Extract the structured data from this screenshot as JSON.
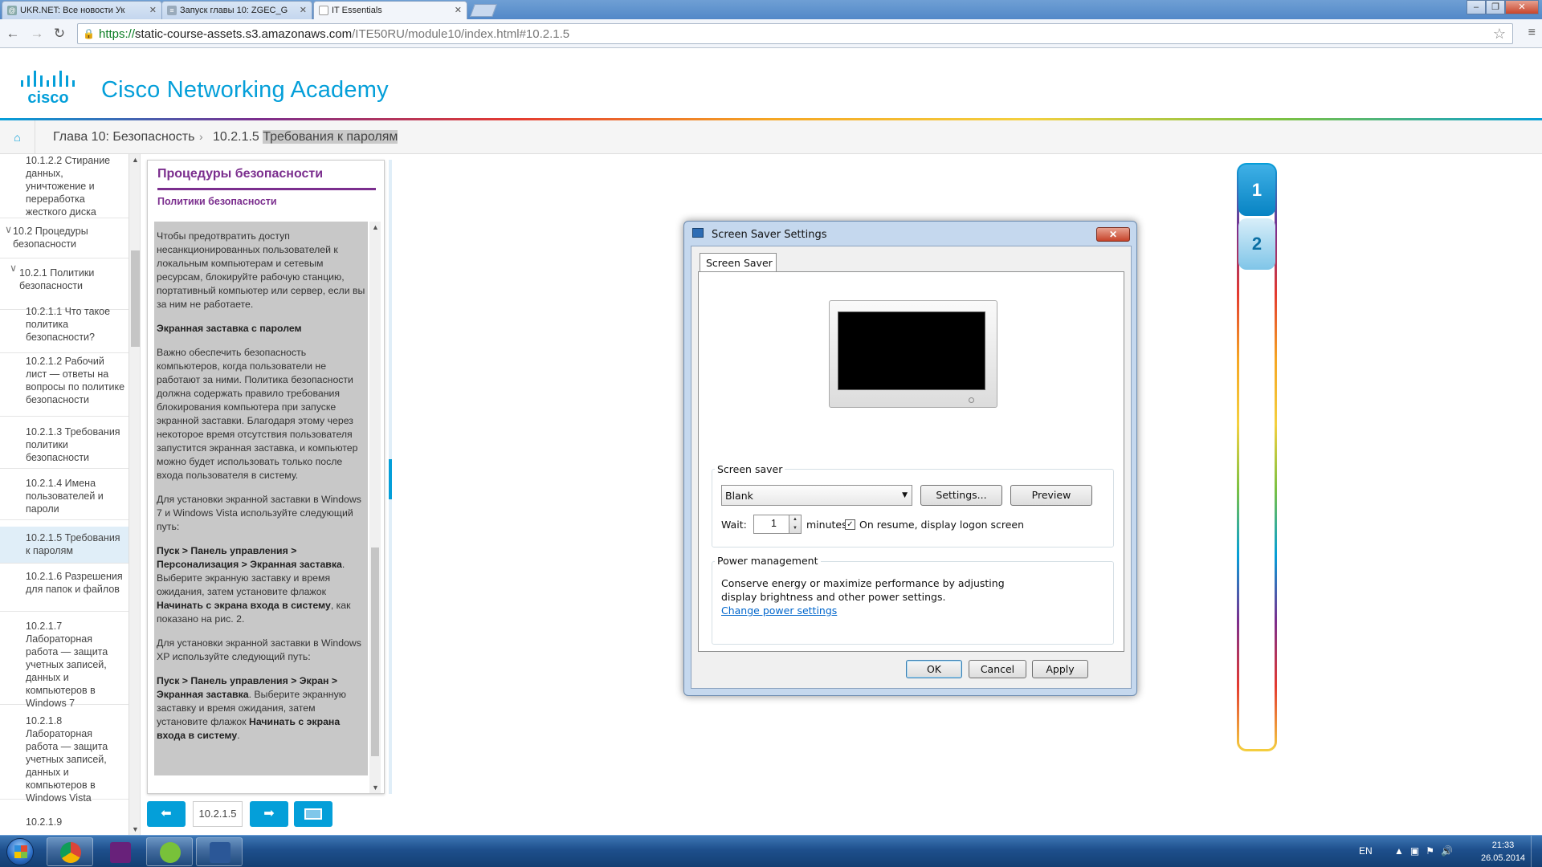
{
  "browser": {
    "tabs": [
      {
        "label": "UKR.NET: Все новости Ук",
        "icon": "ukrnet-favicon"
      },
      {
        "label": "Запуск главы 10: ZGEC_G",
        "icon": "zgec-favicon"
      },
      {
        "label": "IT Essentials",
        "icon": "page-favicon"
      }
    ],
    "url_scheme": "https://",
    "url_host": "static-course-assets.s3.amazonaws.com",
    "url_path": "/ITE50RU/module10/index.html#10.2.1.5"
  },
  "header": {
    "logo_text": "cisco",
    "academy_title": "Cisco Networking Academy"
  },
  "breadcrumb": {
    "chapter": "Глава 10: Безопасность",
    "section_num": "10.2.1.5",
    "section_title": "Требования к паролям"
  },
  "leftnav": {
    "items": [
      {
        "label": "10.1.2.2 Стирание данных, уничтожение и переработка жесткого диска"
      },
      {
        "label": "10.2 Процедуры безопасности"
      },
      {
        "label": "10.2.1 Политики безопасности"
      },
      {
        "label": "10.2.1.1 Что такое политика безопасности?"
      },
      {
        "label": "10.2.1.2 Рабочий лист — ответы на вопросы по политике безопасности"
      },
      {
        "label": "10.2.1.3 Требования политики безопасности"
      },
      {
        "label": "10.2.1.4 Имена пользователей и пароли"
      },
      {
        "label": "10.2.1.5 Требования к паролям"
      },
      {
        "label": "10.2.1.6 Разрешения для папок и файлов"
      },
      {
        "label": "10.2.1.7 Лабораторная работа — защита учетных записей, данных и компьютеров в Windows 7"
      },
      {
        "label": "10.2.1.8 Лабораторная работа — защита учетных записей, данных и компьютеров в Windows Vista"
      },
      {
        "label": "10.2.1.9"
      }
    ]
  },
  "panel": {
    "title": "Процедуры безопасности",
    "subtitle": "Политики безопасности",
    "p1": "Чтобы предотвратить доступ несанкционированных пользователей к локальным компьютерам и сетевым ресурсам, блокируйте рабочую станцию, портативный компьютер или сервер, если вы за ним не работаете.",
    "h1": "Экранная заставка с паролем",
    "p2": "Важно обеспечить безопасность компьютеров, когда пользователи не работают за ними. Политика безопасности должна содержать правило требования блокирования компьютера при запуске экранной заставки. Благодаря этому через некоторое время отсутствия пользователя запустится экранная заставка, и компьютер можно будет использовать только после входа пользователя в систему.",
    "p3": "Для установки экранной заставки в Windows 7 и Windows Vista используйте следующий путь:",
    "p4_bold1": "Пуск > Панель управления > Персонализация > Экранная заставка",
    "p4_text1": ". Выберите экранную заставку и время ожидания, затем установите флажок ",
    "p4_bold2": "Начинать с экрана входа в систему",
    "p4_text2": ", как показано на рис. 2.",
    "p5": "Для установки экранной заставки в Windows XP используйте следующий путь:",
    "p6_bold1": "Пуск > Панель управления > Экран > Экранная заставка",
    "p6_text1": ". Выберите экранную заставку и время ожидания, затем установите флажок ",
    "p6_bold2": "Начинать с экрана входа в систему",
    "p6_text2": "."
  },
  "pager": {
    "page_num": "10.2.1.5"
  },
  "figure_tabs": [
    "1",
    "2"
  ],
  "dialog": {
    "title": "Screen Saver Settings",
    "close": "✕",
    "tab_label": "Screen Saver",
    "screensaver_group": "Screen saver",
    "screensaver_value": "Blank",
    "settings_btn": "Settings...",
    "preview_btn": "Preview",
    "wait_label": "Wait:",
    "wait_value": "1",
    "minutes_label": "minutes",
    "resume_checked": true,
    "resume_label": "On resume, display logon screen",
    "power_group": "Power management",
    "power_text": "Conserve energy or maximize performance by adjusting display brightness and other power settings.",
    "power_link": "Change power settings",
    "ok_btn": "OK",
    "cancel_btn": "Cancel",
    "apply_btn": "Apply"
  },
  "taskbar": {
    "lang": "EN",
    "time": "21:33",
    "date": "26.05.2014",
    "apps": [
      "chrome-icon",
      "visual-studio-icon",
      "utorrent-icon",
      "word-icon"
    ]
  },
  "colors": {
    "cisco_blue": "#049fd9",
    "purple": "#7b2e8e"
  }
}
